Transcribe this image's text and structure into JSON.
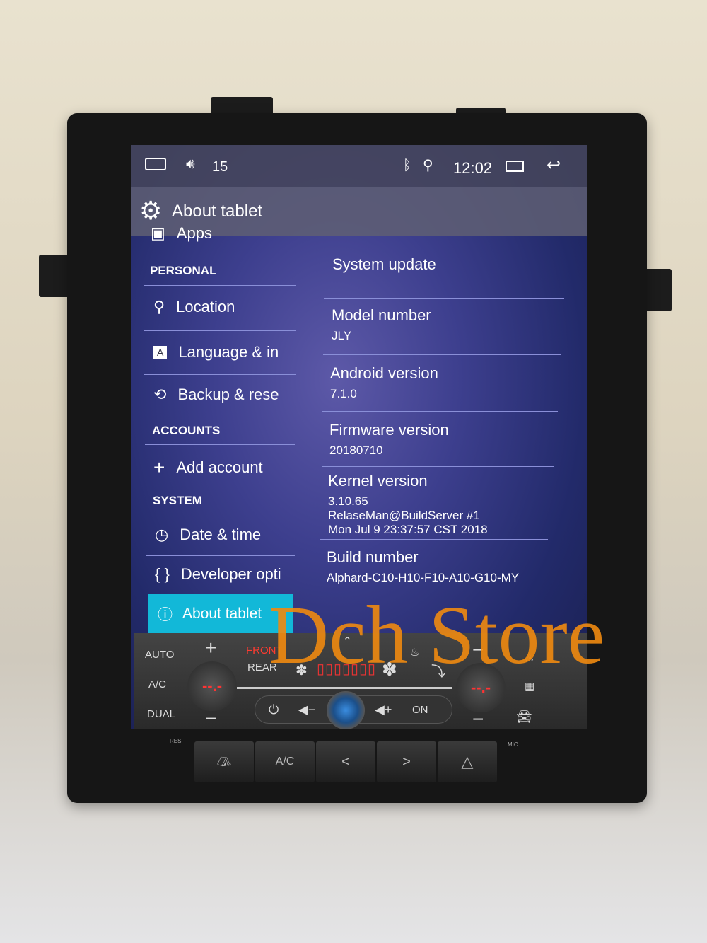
{
  "status_bar": {
    "volume": "15",
    "time": "12:02",
    "icons": [
      "home-icon",
      "volume-icon",
      "bluetooth-icon",
      "location-icon",
      "recents-icon",
      "back-icon"
    ]
  },
  "title_bar": {
    "title": "About tablet",
    "icon": "gear-icon"
  },
  "sidebar": {
    "partial_item": "Apps",
    "sections": [
      {
        "header": "PERSONAL",
        "items": [
          {
            "label": "Location",
            "icon": "location-icon"
          },
          {
            "label": "Language & in",
            "icon": "language-icon"
          },
          {
            "label": "Backup & rese",
            "icon": "backup-icon"
          }
        ]
      },
      {
        "header": "ACCOUNTS",
        "items": [
          {
            "label": "Add account",
            "icon": "plus-icon"
          }
        ]
      },
      {
        "header": "SYSTEM",
        "items": [
          {
            "label": "Date & time",
            "icon": "clock-icon"
          },
          {
            "label": "Developer opti",
            "icon": "braces-icon"
          },
          {
            "label": "About tablet",
            "icon": "info-icon",
            "selected": true
          }
        ]
      }
    ]
  },
  "details": [
    {
      "title": "System update"
    },
    {
      "title": "Model number",
      "value": "JLY"
    },
    {
      "title": "Android version",
      "value": "7.1.0"
    },
    {
      "title": "Firmware version",
      "value": "20180710"
    },
    {
      "title": "Kernel version",
      "value": "3.10.65",
      "value2": "RelaseMan@BuildServer #1",
      "value3": "Mon Jul 9 23:37:57 CST 2018"
    },
    {
      "title": "Build number",
      "value": "Alphard-C10-H10-F10-A10-G10-MY"
    }
  ],
  "climate": {
    "auto": "AUTO",
    "ac": "A/C",
    "dual": "DUAL",
    "front": "FRONT",
    "rear": "REAR",
    "on": "ON",
    "temp_left": "--.-",
    "temp_right": "--.-",
    "accent": "#ff3b30"
  },
  "physical_buttons": {
    "res": "RES",
    "mic": "MIC",
    "ac": "A/C",
    "prev": "<",
    "next": ">"
  },
  "watermark": "Dch Store",
  "colors": {
    "selected": "#12b8d8",
    "divider": "#8a8fd8",
    "watermark": "#f08a10"
  }
}
